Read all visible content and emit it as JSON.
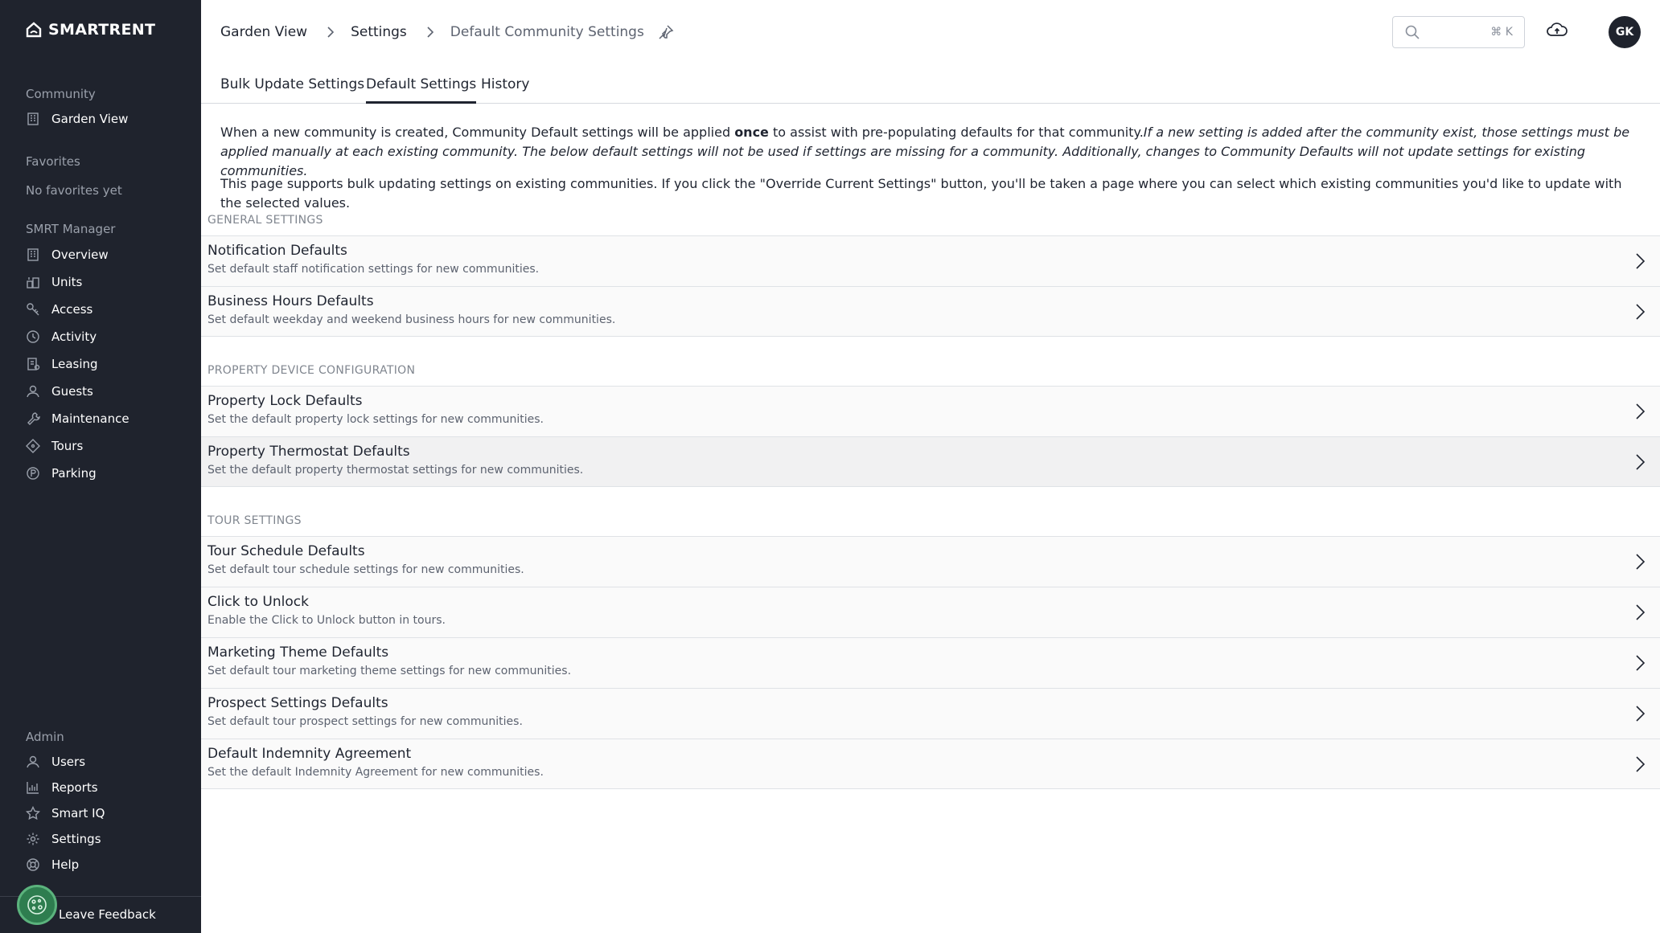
{
  "brand": {
    "name": "SMARTRENT"
  },
  "sidebar": {
    "community_label": "Community",
    "community_item": {
      "label": "Garden View",
      "icon": "building-icon"
    },
    "favorites_label": "Favorites",
    "favorites_empty": "No favorites yet",
    "manager_label": "SMRT Manager",
    "manager_items": [
      {
        "label": "Overview",
        "icon": "building-icon"
      },
      {
        "label": "Units",
        "icon": "units-icon"
      },
      {
        "label": "Access",
        "icon": "key-icon"
      },
      {
        "label": "Activity",
        "icon": "clock-icon"
      },
      {
        "label": "Leasing",
        "icon": "leasing-icon"
      },
      {
        "label": "Guests",
        "icon": "guests-icon"
      },
      {
        "label": "Maintenance",
        "icon": "wrench-icon"
      },
      {
        "label": "Tours",
        "icon": "tag-icon"
      },
      {
        "label": "Parking",
        "icon": "parking-icon"
      }
    ],
    "admin_label": "Admin",
    "admin_items": [
      {
        "label": "Users",
        "icon": "users-icon"
      },
      {
        "label": "Reports",
        "icon": "chart-icon"
      },
      {
        "label": "Smart IQ",
        "icon": "star-icon"
      },
      {
        "label": "Settings",
        "icon": "gear-icon"
      },
      {
        "label": "Help",
        "icon": "lifebuoy-icon"
      }
    ],
    "feedback_label": "Leave Feedback"
  },
  "header": {
    "breadcrumb": [
      "Garden View",
      "Settings",
      "Default Community Settings"
    ],
    "search_placeholder": "",
    "search_shortcut": "⌘ K",
    "avatar_initials": "GK"
  },
  "tabs": [
    {
      "label": "Bulk Update Settings",
      "active": false
    },
    {
      "label": "Default Settings",
      "active": true
    },
    {
      "label": "History",
      "active": false
    }
  ],
  "intro": {
    "p1_before": "When a new community is created, Community Default settings will be applied ",
    "p1_bold": "once",
    "p1_after": " to assist with pre-populating defaults for that community.",
    "p1_italic": "If a new setting is added after the community exist, those settings must be applied manually at each existing community. The below default settings will not be used if settings are missing for a community. Additionally, changes to Community Defaults will not update settings for existing communities.",
    "p2": "This page supports bulk updating settings on existing communities. If you click the \"Override Current Settings\" button, you'll be taken a page where you can select which existing communities you'd like to update with the selected values."
  },
  "groups": [
    {
      "label": "GENERAL SETTINGS",
      "rows": [
        {
          "title": "Notification Defaults",
          "desc": "Set default staff notification settings for new communities."
        },
        {
          "title": "Business Hours Defaults",
          "desc": "Set default weekday and weekend business hours for new communities."
        }
      ]
    },
    {
      "label": "PROPERTY DEVICE CONFIGURATION",
      "rows": [
        {
          "title": "Property Lock Defaults",
          "desc": "Set the default property lock settings for new communities."
        },
        {
          "title": "Property Thermostat Defaults",
          "desc": "Set the default property thermostat settings for new communities."
        }
      ]
    },
    {
      "label": "TOUR SETTINGS",
      "rows": [
        {
          "title": "Tour Schedule Defaults",
          "desc": "Set default tour schedule settings for new communities."
        },
        {
          "title": "Click to Unlock",
          "desc": "Enable the Click to Unlock button in tours."
        },
        {
          "title": "Marketing Theme Defaults",
          "desc": "Set default tour marketing theme settings for new communities."
        },
        {
          "title": "Prospect Settings Defaults",
          "desc": "Set default tour prospect settings for new communities."
        },
        {
          "title": "Default Indemnity Agreement",
          "desc": "Set the default Indemnity Agreement for new communities."
        }
      ]
    }
  ]
}
